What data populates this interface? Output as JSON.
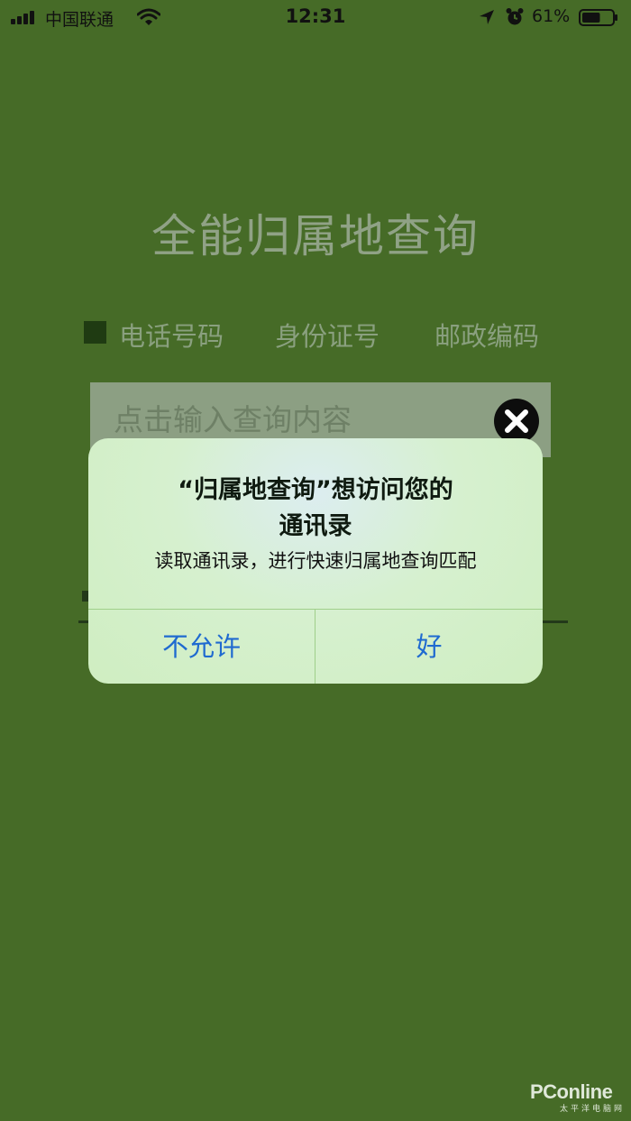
{
  "status_bar": {
    "carrier": "中国联通",
    "time": "12:31",
    "battery_percent": "61%",
    "battery_level": 0.61,
    "icons": [
      "signal-icon",
      "wifi-icon",
      "location-icon",
      "alarm-icon",
      "battery-icon"
    ]
  },
  "app": {
    "title": "全能归属地查询",
    "options": [
      {
        "label": "电话号码",
        "selected": true
      },
      {
        "label": "身份证号",
        "selected": false
      },
      {
        "label": "邮政编码",
        "selected": false
      }
    ],
    "search_placeholder": "点击输入查询内容"
  },
  "alert": {
    "title_line1": "“归属地查询”想访问您的",
    "title_line2": "通讯录",
    "message": "读取通讯录，进行快速归属地查询匹配",
    "deny_label": "不允许",
    "allow_label": "好"
  },
  "watermark": {
    "brand": "PConline",
    "sub": "太平洋电脑网"
  },
  "colors": {
    "background": "#466b27",
    "dialog": "#d6f0cf",
    "button_text": "#1f6ad0"
  }
}
